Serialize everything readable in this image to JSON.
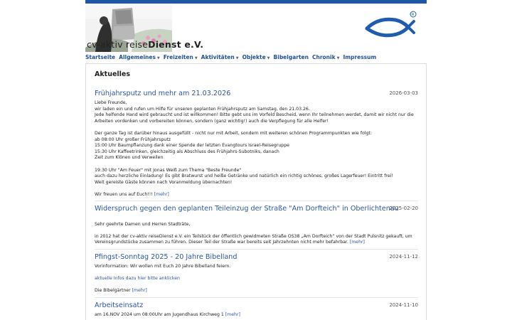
{
  "brand": {
    "part1": "cv-aktiv reise",
    "part2": "Dienst e.V."
  },
  "nav": [
    {
      "label": "Startseite",
      "caret": false
    },
    {
      "label": "Allgemeines",
      "caret": true
    },
    {
      "label": "Freizeiten",
      "caret": true
    },
    {
      "label": "Aktivitäten",
      "caret": true
    },
    {
      "label": "Objekte",
      "caret": true
    },
    {
      "label": "Bibelgarten",
      "caret": false
    },
    {
      "label": "Chronik",
      "caret": true
    },
    {
      "label": "Impressum",
      "caret": false
    }
  ],
  "page_title": "Aktuelles",
  "mehr_label": "[mehr]",
  "posts": [
    {
      "title": "Frühjahrsputz und mehr am 21.03.2026",
      "date": "2026-03-03",
      "lines": [
        "Liebe Freunde,",
        "wir laden ein und rufen um Hilfe für unseren geplanten Frühjahrsputz am Samstag, den 21.03.26.",
        "Jede helfende Hand wird gebraucht und ist willkommen! Bitte gebt uns im Vorfeld Bescheid, wenn Ihr teilnehmen werdet, damit wir nicht nur die",
        "Arbeiten vordenken und vorbereiten können, sondern (ganz wichtig!) auch die Verpflegung für alle Helfer!",
        "",
        "Der ganze Tag ist darüber hinaus ausgefüllt - nicht nur mit Arbeit, sondern mit weiteren schönen Programmpunkten wie folgt:",
        "ab 08:00 Uhr großer Frühjahrsputz",
        "15:00 Uhr Baumpflanzung dank einer Spende der letzten Evangtours Israel-Reisegruppe",
        "15:30 Uhr Kaffeetrinken, gleichzeitig als Abschluss des Frühjahrs-Subotniks, danach",
        "Zeit zum Klönen und Verweilen",
        "",
        "19:30 Uhr \"Am Feuer\" mit Jonas Weiß zum Thema \"Beste Freunde\"",
        "auch dazu herzliche Einladung! Es gibt Bratwurst und heiße Getränke und natürlich ein richtig schönes, großes Lagerfeuer! Eintritt frei!",
        "Weit gereiste Gäste können nach Voranmeldung übernachten!",
        "",
        "Wir freuen uns auf Euch!!!"
      ]
    },
    {
      "title": "Widerspruch gegen den geplanten Teileinzug der Straße \"Am Dorfteich\" in Oberlichtenau",
      "date": "2025-02-20",
      "lines": [
        "",
        "Sehr geehrte Damen und Herren Stadträte,",
        "",
        "in 2012 hat der cv-aktiv reiseDienst e.V. ein Teilstück der öffentlich gewidmeten Straße OS38 „Am Dorfteich“ von der Stadt Pulsnitz gekauft, um",
        "Vereinsgrundstücke zusammen zu führen. Dieser Teil der Straße war bereits seit Jahrzehnten nicht mehr befahrbar."
      ]
    },
    {
      "title": "Pfingst-Sonntag 2025 - 20 Jahre Bibelland",
      "date": "2024-11-12",
      "lines": [
        "Vorinformation: Wir wollen mit Euch 20 Jahre Bibelland feiern.",
        "",
        "aktuelle Infos dazu hier bitte anklicken",
        "",
        "Die Bibelgärtner"
      ]
    },
    {
      "title": "Arbeitseinsatz",
      "date": "2024-11-10",
      "lines": [
        "am 16.NOV 2024 um 08:00Uhr am Jugendhaus Kirchweg 1"
      ]
    }
  ]
}
